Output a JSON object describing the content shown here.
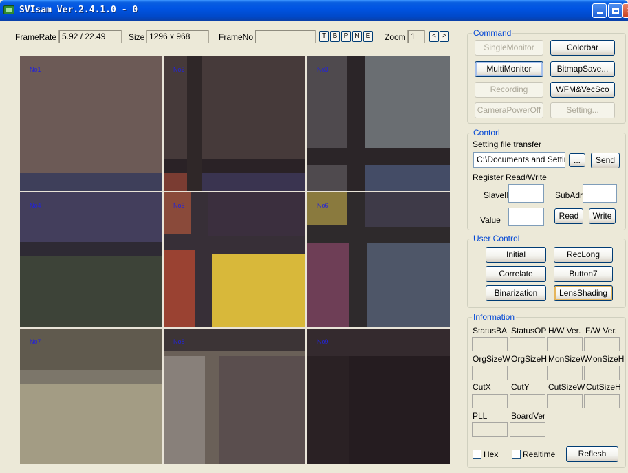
{
  "window": {
    "title": "SVIsam Ver.2.4.1.0 - 0",
    "minimize_glyph": "",
    "maximize_glyph": "",
    "close_glyph": "✕"
  },
  "infobar": {
    "framerate_label": "FrameRate",
    "framerate_value": "5.92 / 22.49",
    "size_label": "Size",
    "size_value": "1296 x 968",
    "frameno_label": "FrameNo",
    "frameno_value": "",
    "letter_buttons": [
      "T",
      "B",
      "P",
      "N",
      "E"
    ],
    "zoom_label": "Zoom",
    "zoom_value": "1",
    "zoom_prev": "<",
    "zoom_next": ">"
  },
  "monitors": [
    {
      "label": "No1"
    },
    {
      "label": "No2"
    },
    {
      "label": "No3"
    },
    {
      "label": "No4"
    },
    {
      "label": "No5"
    },
    {
      "label": "No6"
    },
    {
      "label": "No7"
    },
    {
      "label": "No8"
    },
    {
      "label": "No9"
    }
  ],
  "command": {
    "title": "Command",
    "single_monitor": "SingleMonitor",
    "colorbar": "Colorbar",
    "multi_monitor": "MultiMonitor",
    "bitmap_save": "BitmapSave...",
    "recording": "Recording",
    "wfm_vecsco": "WFM&VecSco",
    "camera_power_off": "CameraPowerOff",
    "setting": "Setting..."
  },
  "control": {
    "title": "Contorl",
    "setting_file_transfer": "Setting file transfer",
    "file_path": "C:\\Documents and Settir",
    "browse": "...",
    "send": "Send",
    "register_rw": "Register Read/Write",
    "slave_id_label": "SlaveID",
    "slave_id_value": "",
    "sub_adr_label": "SubAdr",
    "sub_adr_value": "",
    "value_label": "Value",
    "value_value": "",
    "read": "Read",
    "write": "Write"
  },
  "user_control": {
    "title": "User Control",
    "initial": "Initial",
    "rec_long": "RecLong",
    "correlate": "Correlate",
    "button7": "Button7",
    "binarization": "Binarization",
    "lens_shading": "LensShading"
  },
  "information": {
    "title": "Information",
    "row1": [
      "StatusBA",
      "StatusOP",
      "H/W Ver.",
      "F/W Ver."
    ],
    "row2": [
      "OrgSizeW",
      "OrgSizeH",
      "MonSizeW",
      "MonSizeH"
    ],
    "row3": [
      "CutX",
      "CutY",
      "CutSizeW",
      "CutSizeH"
    ],
    "row4": [
      "PLL",
      "BoardVer"
    ],
    "hex_label": "Hex",
    "realtime_label": "Realtime",
    "refresh": "Reflesh"
  },
  "colors": {
    "titlebar_blue": "#0054e3",
    "window_bg": "#ece9d8",
    "group_title": "#0046d5",
    "monitor_label": "#2323d8"
  }
}
